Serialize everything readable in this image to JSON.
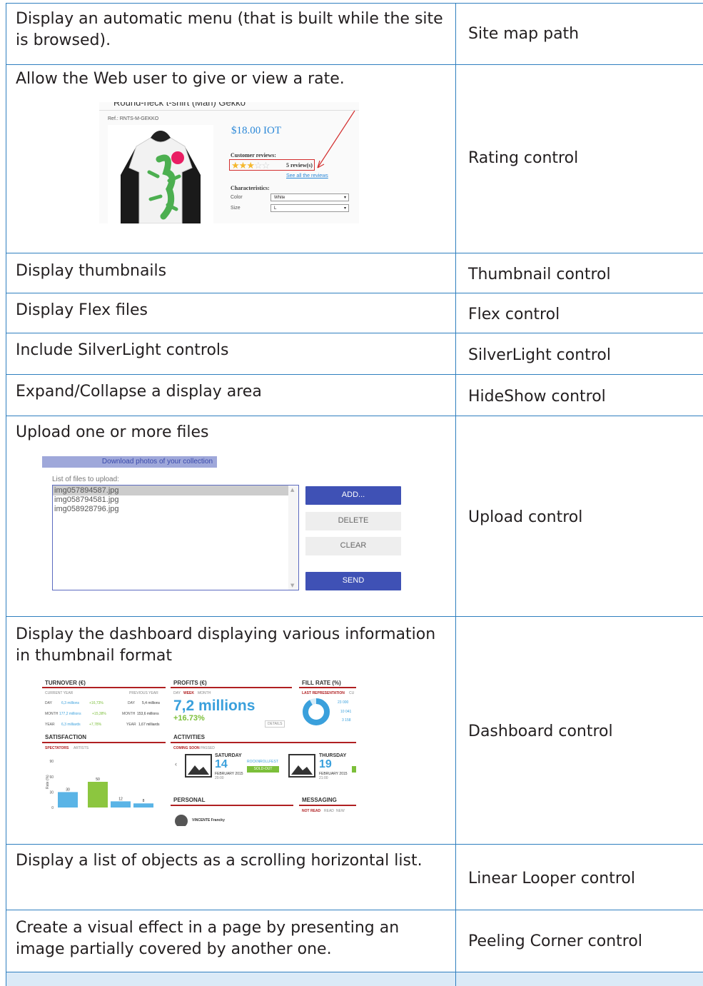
{
  "rows": [
    {
      "description": "Display an automatic menu (that is built while the site is browsed).",
      "control": "Site map path"
    },
    {
      "description": "Allow the Web user to give or view a rate.",
      "control": "Rating control"
    },
    {
      "description": "Display thumbnails",
      "control": "Thumbnail control"
    },
    {
      "description": "Display Flex files",
      "control": "Flex control"
    },
    {
      "description": "Include SilverLight controls",
      "control": "SilverLight control"
    },
    {
      "description": "Expand/Collapse a display area",
      "control": "HideShow control"
    },
    {
      "description": "Upload one or more files",
      "control": "Upload control"
    },
    {
      "description": "Display the dashboard displaying various information in thumbnail format",
      "control": "Dashboard control"
    },
    {
      "description": "Display a list of objects as a scrolling horizontal list.",
      "control": "Linear Looper control"
    },
    {
      "description": "Create a visual effect in a page by presenting an image partially covered by another one.",
      "control": "Peeling Corner control"
    }
  ],
  "rating_shot": {
    "title": "Round-neck t-shirt (Man) Gekko",
    "ref": "Ref.: RNTS-M-GEKKO",
    "price": "$18.00 IOT",
    "reviews_heading": "Customer reviews:",
    "reviews_count": "5 review(s)",
    "see_all": "See all the reviews",
    "characteristics": "Characteristics:",
    "color_label": "Color",
    "color_value": "White",
    "size_label": "Size",
    "size_value": "L",
    "star_rating": 3,
    "star_max": 5
  },
  "upload_shot": {
    "header": "Download photos of your collection",
    "list_label": "List of files to upload:",
    "files": [
      "img057894587.jpg",
      "img058794581.jpg",
      "img058928796.jpg"
    ],
    "add": "ADD...",
    "delete": "DELETE",
    "clear": "CLEAR",
    "send": "SEND"
  },
  "dashboard_shot": {
    "turnover": "TURNOVER (€)",
    "profits": "PROFITS (€)",
    "fill_rate": "FILL RATE (%)",
    "current_year": "CURRENT YEAR",
    "previous_year": "PREVIOUS YEAR",
    "day": "DAY",
    "week": "WEEK",
    "month": "MONTH",
    "t_day": "6,3 millions",
    "t_day_pct": "+16,73%",
    "t_day_prev": "5,4 millions",
    "t_month_label": "MONTH",
    "t_month": "177,2 millions",
    "t_month_pct": "+15,38%",
    "t_month_prev": "153,6 millions",
    "t_year_label": "YEAR",
    "t_year": "6,3 milliards",
    "t_year_pct": "+7,78%",
    "t_year_prev": "1,67 milliards",
    "profit_value": "7,2 millions",
    "profit_pct": "+16.73%",
    "details": "DETAILS",
    "last_rep": "LAST REPRESENTATION",
    "last_rep_cut": "CU",
    "fill_pct": "92%",
    "fill_fraction": 0.92,
    "fill_a": "23 000",
    "fill_b": "10 041",
    "fill_c": "3 158",
    "satisfaction": "SATISFACTION",
    "spectators": "SPECTATORS",
    "artists": "ARTISTS",
    "rate_axis": "Rate (%)",
    "activities": "ACTIVITIES",
    "coming_soon": "COMING SOON",
    "passed": "PASSED",
    "sat": "SATURDAY",
    "sat_num": "14",
    "sat_date": "FEBRUARY 2015",
    "sat_time": "20:00",
    "rock": "ROCKNROLLFEST",
    "sold_out": "SOLD-OUT",
    "thu": "THURSDAY",
    "thu_num": "19",
    "thu_date": "FEBRUARY 2015",
    "thu_time": "21:00",
    "personal": "PERSONAL",
    "person": "VINCENTE Francky",
    "messaging": "MESSAGING",
    "not_read": "NOT READ",
    "read": "READ",
    "new": "NEW"
  },
  "chart_data": {
    "type": "bar",
    "categories": [
      "",
      "",
      "",
      ""
    ],
    "values": [
      30,
      50,
      12,
      8
    ],
    "ylabel": "Rate (%)",
    "yticks": [
      0,
      30,
      60,
      90
    ],
    "ylim": [
      0,
      100
    ],
    "colors": [
      "#5ab4e6",
      "#8cc63f",
      "#5ab4e6",
      "#5ab4e6"
    ]
  }
}
